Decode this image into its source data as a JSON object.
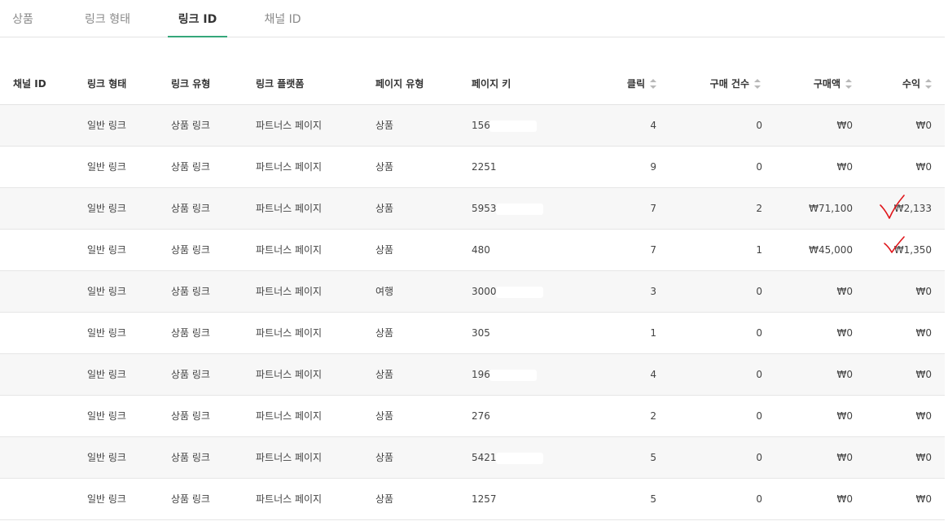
{
  "tabs": [
    "상품",
    "링크 형태",
    "링크 ID",
    "채널 ID"
  ],
  "active_tab": 2,
  "table": {
    "headers": {
      "channel_id": "채널 ID",
      "link_form": "링크 형태",
      "link_type": "링크 유형",
      "link_platform": "링크 플랫폼",
      "page_type": "페이지 유형",
      "page_key": "페이지 키",
      "clicks": "클릭",
      "purchase_count": "구매 건수",
      "purchase_amount": "구매액",
      "revenue": "수익"
    },
    "rows": [
      {
        "channel_id": "",
        "link_form": "일반 링크",
        "link_type": "상품 링크",
        "link_platform": "파트너스 페이지",
        "page_type": "상품",
        "page_key": "156",
        "clicks": "4",
        "purchase_count": "0",
        "purchase_amount": "₩0",
        "revenue": "₩0"
      },
      {
        "channel_id": "",
        "link_form": "일반 링크",
        "link_type": "상품 링크",
        "link_platform": "파트너스 페이지",
        "page_type": "상품",
        "page_key": "2251",
        "clicks": "9",
        "purchase_count": "0",
        "purchase_amount": "₩0",
        "revenue": "₩0"
      },
      {
        "channel_id": "",
        "link_form": "일반 링크",
        "link_type": "상품 링크",
        "link_platform": "파트너스 페이지",
        "page_type": "상품",
        "page_key": "5953",
        "clicks": "7",
        "purchase_count": "2",
        "purchase_amount": "₩71,100",
        "revenue": "₩2,133"
      },
      {
        "channel_id": "",
        "link_form": "일반 링크",
        "link_type": "상품 링크",
        "link_platform": "파트너스 페이지",
        "page_type": "상품",
        "page_key": "480",
        "clicks": "7",
        "purchase_count": "1",
        "purchase_amount": "₩45,000",
        "revenue": "₩1,350"
      },
      {
        "channel_id": "",
        "link_form": "일반 링크",
        "link_type": "상품 링크",
        "link_platform": "파트너스 페이지",
        "page_type": "여행",
        "page_key": "3000",
        "clicks": "3",
        "purchase_count": "0",
        "purchase_amount": "₩0",
        "revenue": "₩0"
      },
      {
        "channel_id": "",
        "link_form": "일반 링크",
        "link_type": "상품 링크",
        "link_platform": "파트너스 페이지",
        "page_type": "상품",
        "page_key": "305",
        "clicks": "1",
        "purchase_count": "0",
        "purchase_amount": "₩0",
        "revenue": "₩0"
      },
      {
        "channel_id": "",
        "link_form": "일반 링크",
        "link_type": "상품 링크",
        "link_platform": "파트너스 페이지",
        "page_type": "상품",
        "page_key": "196",
        "clicks": "4",
        "purchase_count": "0",
        "purchase_amount": "₩0",
        "revenue": "₩0"
      },
      {
        "channel_id": "",
        "link_form": "일반 링크",
        "link_type": "상품 링크",
        "link_platform": "파트너스 페이지",
        "page_type": "상품",
        "page_key": "276",
        "clicks": "2",
        "purchase_count": "0",
        "purchase_amount": "₩0",
        "revenue": "₩0"
      },
      {
        "channel_id": "",
        "link_form": "일반 링크",
        "link_type": "상품 링크",
        "link_platform": "파트너스 페이지",
        "page_type": "상품",
        "page_key": "5421",
        "clicks": "5",
        "purchase_count": "0",
        "purchase_amount": "₩0",
        "revenue": "₩0"
      },
      {
        "channel_id": "",
        "link_form": "일반 링크",
        "link_type": "상품 링크",
        "link_platform": "파트너스 페이지",
        "page_type": "상품",
        "page_key": "1257",
        "clicks": "5",
        "purchase_count": "0",
        "purchase_amount": "₩0",
        "revenue": "₩0"
      }
    ]
  },
  "colors": {
    "active_tab_underline": "#35a77a",
    "annotation_check": "#e0161b",
    "row_shade": "#f7f7f7"
  }
}
